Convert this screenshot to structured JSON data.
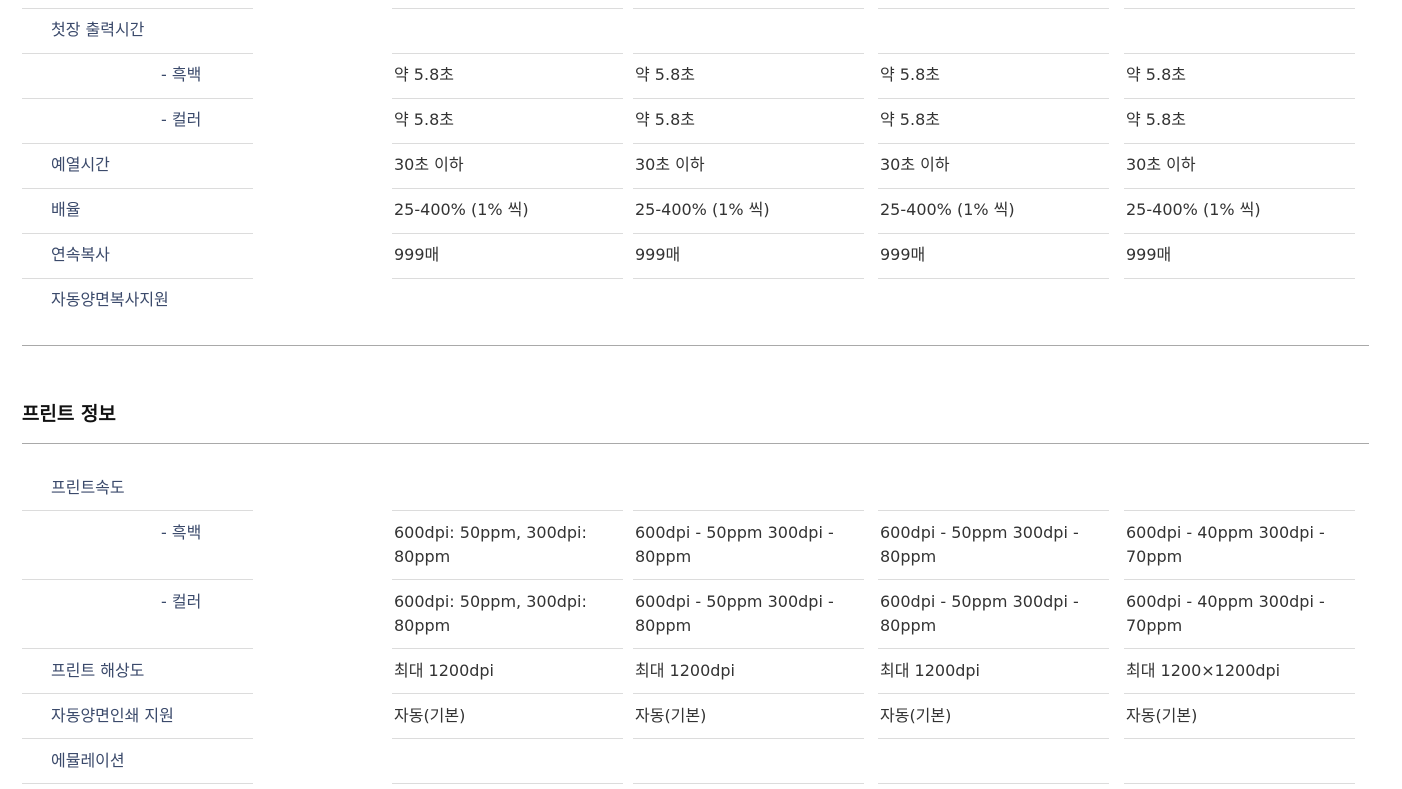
{
  "copy_section": {
    "rows": [
      {
        "label": "첫장 출력시간",
        "values": [
          "",
          "",
          "",
          ""
        ]
      },
      {
        "label": "- 흑백",
        "values": [
          "약 5.8초",
          "약 5.8초",
          "약 5.8초",
          "약 5.8초"
        ]
      },
      {
        "label": "- 컬러",
        "values": [
          "약 5.8초",
          "약 5.8초",
          "약 5.8초",
          "약 5.8초"
        ]
      },
      {
        "label": "예열시간",
        "values": [
          "30초 이하",
          "30초 이하",
          "30초 이하",
          "30초 이하"
        ]
      },
      {
        "label": "배율",
        "values": [
          "25-400% (1% 씩)",
          "25-400% (1% 씩)",
          "25-400% (1% 씩)",
          "25-400% (1% 씩)"
        ]
      },
      {
        "label": "연속복사",
        "values": [
          "999매",
          "999매",
          "999매",
          "999매"
        ]
      },
      {
        "label": "자동양면복사지원",
        "values": [
          "",
          "",
          "",
          ""
        ]
      }
    ]
  },
  "print_section": {
    "title": "프린트 정보",
    "rows": [
      {
        "label": "프린트속도",
        "values": [
          "",
          "",
          "",
          ""
        ]
      },
      {
        "label": "- 흑백",
        "values": [
          "600dpi: 50ppm, 300dpi: 80ppm",
          "600dpi - 50ppm 300dpi - 80ppm",
          "600dpi - 50ppm 300dpi - 80ppm",
          "600dpi - 40ppm 300dpi - 70ppm"
        ]
      },
      {
        "label": "- 컬러",
        "values": [
          "600dpi: 50ppm, 300dpi: 80ppm",
          "600dpi - 50ppm 300dpi - 80ppm",
          "600dpi - 50ppm 300dpi - 80ppm",
          "600dpi - 40ppm 300dpi - 70ppm"
        ]
      },
      {
        "label": "프린트 해상도",
        "values": [
          "최대 1200dpi",
          "최대 1200dpi",
          "최대 1200dpi",
          "최대 1200×1200dpi"
        ]
      },
      {
        "label": "자동양면인쇄 지원",
        "values": [
          "자동(기본)",
          "자동(기본)",
          "자동(기본)",
          "자동(기본)"
        ]
      },
      {
        "label": "에뮬레이션",
        "values": [
          "",
          "",
          "",
          ""
        ]
      }
    ]
  }
}
